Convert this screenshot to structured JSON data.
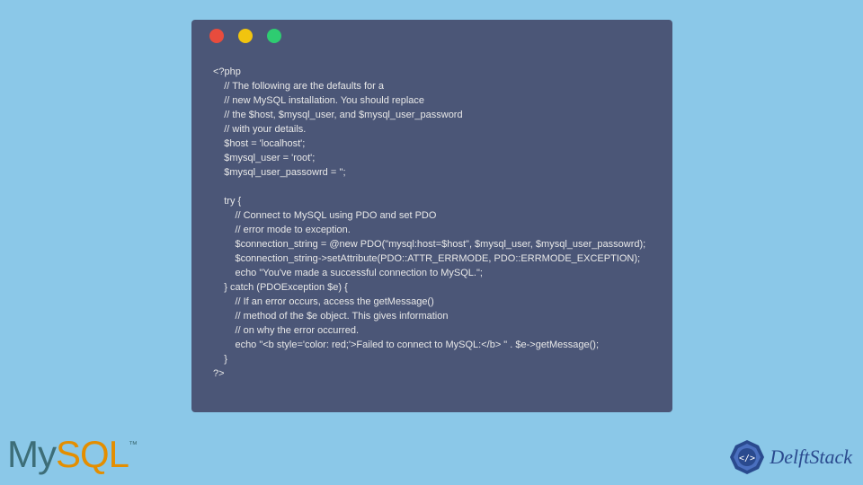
{
  "code": {
    "lines": [
      "<?php",
      "    // The following are the defaults for a",
      "    // new MySQL installation. You should replace",
      "    // the $host, $mysql_user, and $mysql_user_password",
      "    // with your details.",
      "    $host = 'localhost';",
      "    $mysql_user = 'root';",
      "    $mysql_user_passowrd = '';",
      "",
      "    try {",
      "        // Connect to MySQL using PDO and set PDO",
      "        // error mode to exception.",
      "        $connection_string = @new PDO(\"mysql:host=$host\", $mysql_user, $mysql_user_passowrd);",
      "        $connection_string->setAttribute(PDO::ATTR_ERRMODE, PDO::ERRMODE_EXCEPTION);",
      "        echo \"You've made a successful connection to MySQL.\";",
      "    } catch (PDOException $e) {",
      "        // If an error occurs, access the getMessage()",
      "        // method of the $e object. This gives information",
      "        // on why the error occurred.",
      "        echo \"<b style='color: red;'>Failed to connect to MySQL:</b> \" . $e->getMessage();",
      "    }",
      "?>"
    ]
  },
  "logos": {
    "mysql_my": "My",
    "mysql_sql": "SQL",
    "mysql_tm": "™",
    "delft": "DelftStack"
  },
  "colors": {
    "page_bg": "#8bc8e8",
    "window_bg": "#4b5677",
    "dot_red": "#e84c3d",
    "dot_yellow": "#f1c40f",
    "dot_green": "#2ecc71"
  }
}
